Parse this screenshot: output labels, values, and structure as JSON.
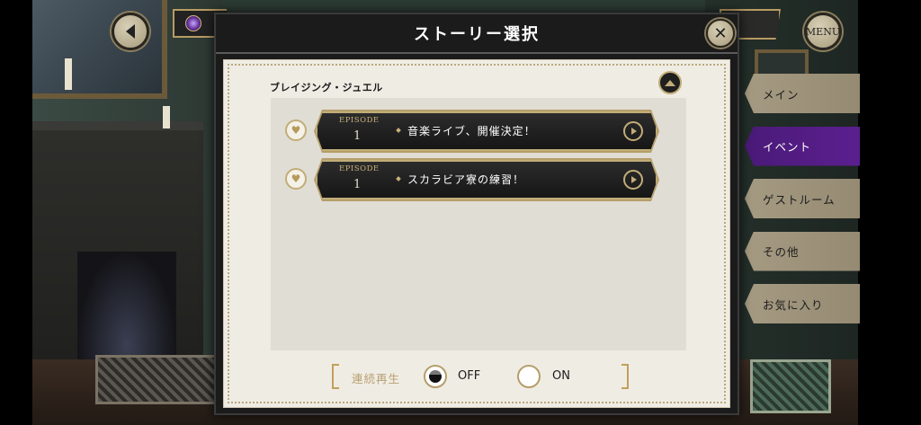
{
  "header": {
    "menu_label": "MENU"
  },
  "modal": {
    "title": "ストーリー選択",
    "section_title": "ブレイジング・ジュエル",
    "episodes": [
      {
        "label": "EPISODE",
        "number": "1",
        "title": "音楽ライブ、開催決定！"
      },
      {
        "label": "EPISODE",
        "number": "1",
        "title": "スカラビア寮の練習！"
      }
    ],
    "continuous_play": {
      "label": "連続再生",
      "off_label": "OFF",
      "on_label": "ON",
      "selected": "OFF"
    }
  },
  "side_tabs": [
    {
      "label": "メイン",
      "active": false
    },
    {
      "label": "イベント",
      "active": true
    },
    {
      "label": "ゲストルーム",
      "active": false
    },
    {
      "label": "その他",
      "active": false
    },
    {
      "label": "お気に入り",
      "active": false
    }
  ],
  "colors": {
    "accent_gold": "#c2ad78",
    "active_tab_purple": "#5b1f8f",
    "paper": "#efece4"
  }
}
